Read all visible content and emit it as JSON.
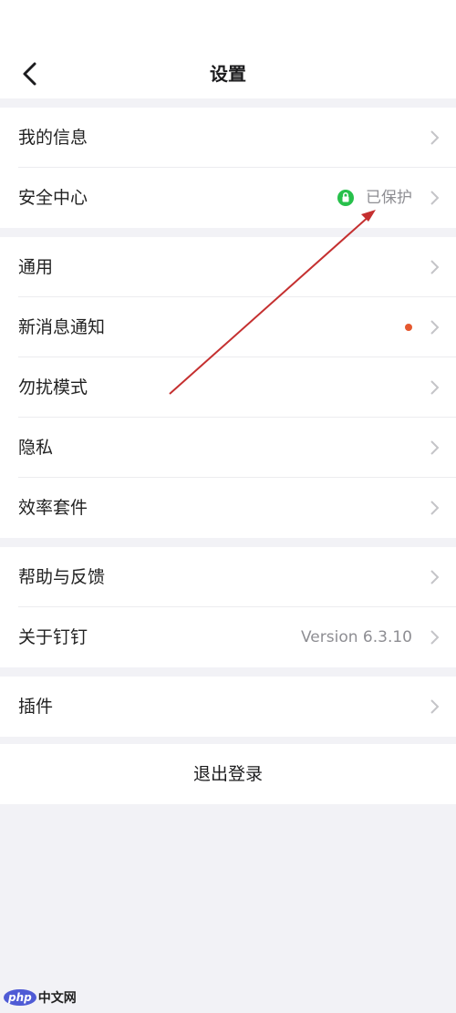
{
  "header": {
    "title": "设置",
    "back_icon": "chevron-left-icon"
  },
  "groups": [
    {
      "items": [
        {
          "label": "我的信息"
        },
        {
          "label": "安全中心",
          "status_text": "已保护",
          "status_icon": "shield-check-icon",
          "status_color": "#27c04b"
        }
      ]
    },
    {
      "items": [
        {
          "label": "通用"
        },
        {
          "label": "新消息通知",
          "badge": "red-dot",
          "badge_color": "#e5582f"
        },
        {
          "label": "勿扰模式"
        },
        {
          "label": "隐私"
        },
        {
          "label": "效率套件"
        }
      ]
    },
    {
      "items": [
        {
          "label": "帮助与反馈"
        },
        {
          "label": "关于钉钉",
          "value": "Version 6.3.10"
        }
      ]
    },
    {
      "items": [
        {
          "label": "插件"
        }
      ]
    }
  ],
  "logout_label": "退出登录",
  "annotation": {
    "type": "arrow",
    "color": "#c53030"
  },
  "watermark": {
    "badge": "php",
    "text": "中文网"
  }
}
